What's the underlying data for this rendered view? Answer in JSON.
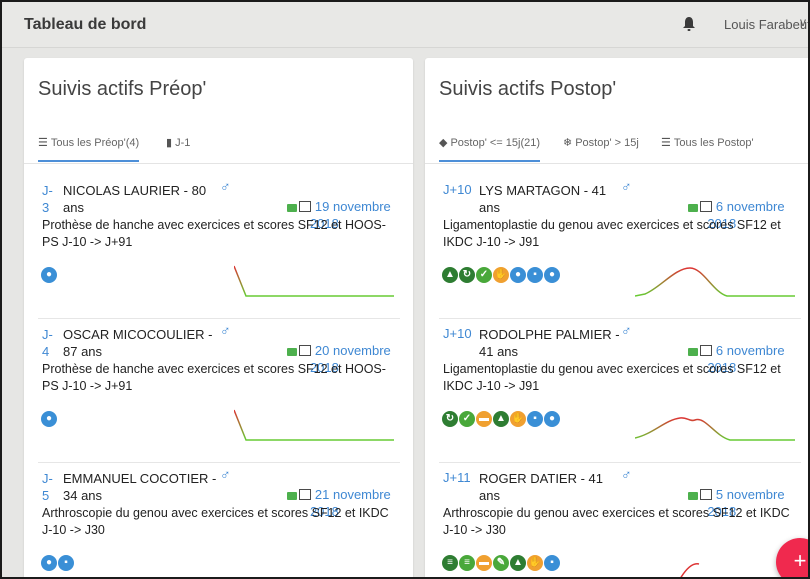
{
  "header": {
    "title": "Tableau de bord",
    "user": "Louis Farabeuf",
    "user_chevron": "v",
    "icons": [
      "bell-icon",
      "chevron-down-icon"
    ]
  },
  "preop": {
    "title": "Suivis actifs Préop'",
    "tabs": [
      {
        "label": "Tous les Préop'(4)",
        "icon": "list-icon",
        "active": true
      },
      {
        "label": "J-1",
        "icon": "document-icon",
        "active": false
      }
    ],
    "patients": [
      {
        "j": "J-\n3",
        "name": "NICOLAS LAURIER - 80\nans",
        "sex": "♂",
        "date": "19 novembre\n2018",
        "desc": "Prothèse de hanche avec exercices et scores SF12 et HOOS-PS J-10 -> J+91"
      },
      {
        "j": "J-\n4",
        "name": "OSCAR MICOCOULIER -\n87 ans",
        "sex": "♂",
        "date": "20 novembre\n2018",
        "desc": "Prothèse de hanche avec exercices et scores SF12 et HOOS-PS J-10 -> J+91"
      },
      {
        "j": "J-\n5",
        "name": "EMMANUEL COCOTIER -\n34 ans",
        "sex": "♂",
        "date": "21 novembre\n2018",
        "desc": "Arthroscopie du genou avec exercices et scores SF12 et IKDC J-10 -> J30"
      }
    ]
  },
  "postop": {
    "title": "Suivis actifs Postop'",
    "tabs": [
      {
        "label": "Postop' <= 15j(21)",
        "icon": "drop-icon",
        "active": true
      },
      {
        "label": "Postop' > 15j",
        "icon": "snowflake-icon",
        "active": false
      },
      {
        "label": "Tous les Postop'",
        "icon": "list-icon",
        "active": false
      }
    ],
    "patients": [
      {
        "j": "J+10",
        "name": "LYS MARTAGON - 41\nans",
        "sex": "♂",
        "date": "6 novembre\n2018",
        "desc": "Ligamentoplastie du genou avec exercices et scores SF12 et IKDC J-10 -> J91"
      },
      {
        "j": "J+10",
        "name": "RODOLPHE PALMIER -\n41 ans",
        "sex": "♂",
        "date": "6 novembre\n2018",
        "desc": "Ligamentoplastie du genou avec exercices et scores SF12 et IKDC J-10 -> J91"
      },
      {
        "j": "J+11",
        "name": "ROGER DATIER - 41\nans",
        "sex": "♂",
        "date": "5 novembre\n2018",
        "desc": "Arthroscopie du genou avec exercices et scores SF12 et IKDC J-10 -> J30"
      }
    ]
  },
  "fab": {
    "label": "+"
  },
  "colors": {
    "accent": "#3f88d3",
    "fab": "#f0294e",
    "green": "#2e7d32",
    "orange": "#f0a030"
  }
}
